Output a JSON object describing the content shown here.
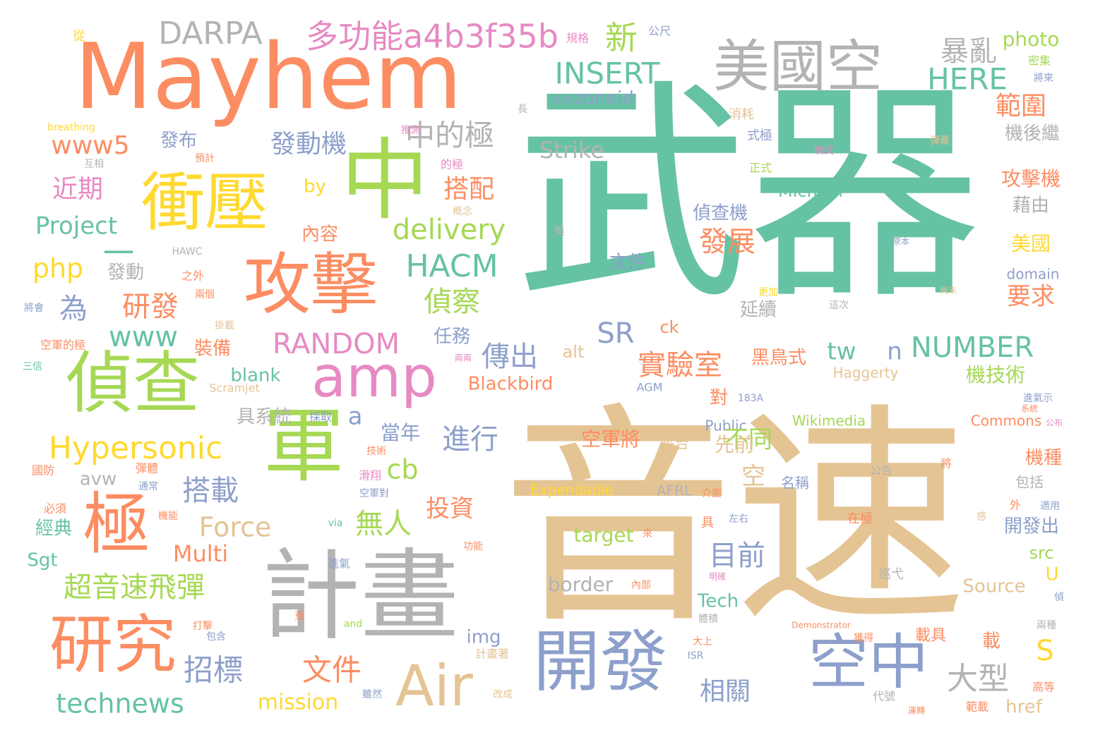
{
  "palette": {
    "teal": "#66c2a5",
    "orange": "#fc8d62",
    "blue": "#8da0cb",
    "pink": "#e78ac3",
    "green": "#a6d854",
    "yellow": "#ffd92f",
    "tan": "#e5c494",
    "gray": "#b3b3b3"
  },
  "words": [
    {
      "text": "武器",
      "color": "teal"
    },
    {
      "text": "音速",
      "color": "tan"
    },
    {
      "text": "Mayhem",
      "color": "orange"
    },
    {
      "text": "計畫",
      "color": "gray"
    },
    {
      "text": "美國空",
      "color": "gray"
    },
    {
      "text": "中",
      "color": "green"
    },
    {
      "text": "衝壓",
      "color": "yellow"
    },
    {
      "text": "偵查",
      "color": "green"
    },
    {
      "text": "攻擊",
      "color": "orange"
    },
    {
      "text": "軍",
      "color": "green"
    },
    {
      "text": "開發",
      "color": "blue"
    },
    {
      "text": "研究",
      "color": "orange"
    },
    {
      "text": "空中",
      "color": "blue"
    },
    {
      "text": "Air",
      "color": "tan"
    },
    {
      "text": "amp",
      "color": "pink"
    },
    {
      "text": "極",
      "color": "orange"
    },
    {
      "text": "多功能a4b3f35b",
      "color": "pink"
    },
    {
      "text": "DARPA",
      "color": "gray"
    },
    {
      "text": "新",
      "color": "green"
    },
    {
      "text": "暴亂",
      "color": "gray"
    },
    {
      "text": "photo",
      "color": "green"
    },
    {
      "text": "INSERT",
      "color": "teal"
    },
    {
      "text": "HERE",
      "color": "teal"
    },
    {
      "text": "zoneid",
      "color": "blue"
    },
    {
      "text": "範圍",
      "color": "orange"
    },
    {
      "text": "中的極",
      "color": "gray"
    },
    {
      "text": "發動機",
      "color": "blue"
    },
    {
      "text": "發布",
      "color": "blue"
    },
    {
      "text": "www5",
      "color": "orange"
    },
    {
      "text": "Strike",
      "color": "gray"
    },
    {
      "text": "機後繼",
      "color": "gray"
    },
    {
      "text": "近期",
      "color": "pink"
    },
    {
      "text": "搭配",
      "color": "orange"
    },
    {
      "text": "攻擊機",
      "color": "orange"
    },
    {
      "text": "by",
      "color": "yellow"
    },
    {
      "text": "Michael",
      "color": "teal"
    },
    {
      "text": "Project",
      "color": "teal"
    },
    {
      "text": "delivery",
      "color": "green"
    },
    {
      "text": "偵查機",
      "color": "blue"
    },
    {
      "text": "藉由",
      "color": "gray"
    },
    {
      "text": "一",
      "color": "teal"
    },
    {
      "text": "內容",
      "color": "orange"
    },
    {
      "text": "發展",
      "color": "orange"
    },
    {
      "text": "美國",
      "color": "yellow"
    },
    {
      "text": "php",
      "color": "yellow"
    },
    {
      "text": "HACM",
      "color": "teal"
    },
    {
      "text": "文件",
      "color": "blue"
    },
    {
      "text": "domain",
      "color": "blue"
    },
    {
      "text": "發動",
      "color": "gray"
    },
    {
      "text": "為",
      "color": "blue"
    },
    {
      "text": "研發",
      "color": "orange"
    },
    {
      "text": "偵察",
      "color": "green"
    },
    {
      "text": "要求",
      "color": "orange"
    },
    {
      "text": "www",
      "color": "teal"
    },
    {
      "text": "SR",
      "color": "blue"
    },
    {
      "text": "延續",
      "color": "gray"
    },
    {
      "text": "ck",
      "color": "orange"
    },
    {
      "text": "RANDOM",
      "color": "pink"
    },
    {
      "text": "任務",
      "color": "blue"
    },
    {
      "text": "tw",
      "color": "teal"
    },
    {
      "text": "n",
      "color": "blue"
    },
    {
      "text": "NUMBER",
      "color": "teal"
    },
    {
      "text": "裝備",
      "color": "orange"
    },
    {
      "text": "傳出",
      "color": "blue"
    },
    {
      "text": "實驗室",
      "color": "orange"
    },
    {
      "text": "黑鳥式",
      "color": "orange"
    },
    {
      "text": "alt",
      "color": "tan"
    },
    {
      "text": "機技術",
      "color": "green"
    },
    {
      "text": "blank",
      "color": "teal"
    },
    {
      "text": "Blackbird",
      "color": "orange"
    },
    {
      "text": "Haggerty",
      "color": "tan"
    },
    {
      "text": "具系統",
      "color": "gray"
    },
    {
      "text": "a",
      "color": "blue"
    },
    {
      "text": "當年",
      "color": "blue"
    },
    {
      "text": "對",
      "color": "orange"
    },
    {
      "text": "Wikimedia",
      "color": "green"
    },
    {
      "text": "Commons",
      "color": "orange"
    },
    {
      "text": "Hypersonic",
      "color": "yellow"
    },
    {
      "text": "進行",
      "color": "blue"
    },
    {
      "text": "空軍將",
      "color": "orange"
    },
    {
      "text": "Public",
      "color": "blue"
    },
    {
      "text": "不同",
      "color": "green"
    },
    {
      "text": "S",
      "color": "yellow"
    },
    {
      "text": "cb",
      "color": "green"
    },
    {
      "text": "平台",
      "color": "tan"
    },
    {
      "text": "先前",
      "color": "tan"
    },
    {
      "text": "機種",
      "color": "orange"
    },
    {
      "text": "avw",
      "color": "gray"
    },
    {
      "text": "搭載",
      "color": "blue"
    },
    {
      "text": "空",
      "color": "tan"
    },
    {
      "text": "名稱",
      "color": "blue"
    },
    {
      "text": "包括",
      "color": "gray"
    },
    {
      "text": "Expendable",
      "color": "yellow"
    },
    {
      "text": "AFRL",
      "color": "gray"
    },
    {
      "text": "投資",
      "color": "orange"
    },
    {
      "text": "無人",
      "color": "green"
    },
    {
      "text": "Force",
      "color": "tan"
    },
    {
      "text": "開發出",
      "color": "blue"
    },
    {
      "text": "經典",
      "color": "teal"
    },
    {
      "text": "target",
      "color": "green"
    },
    {
      "text": "Multi",
      "color": "orange"
    },
    {
      "text": "目前",
      "color": "blue"
    },
    {
      "text": "src",
      "color": "green"
    },
    {
      "text": "Sgt",
      "color": "teal"
    },
    {
      "text": "超音速飛彈",
      "color": "green"
    },
    {
      "text": "border",
      "color": "gray"
    },
    {
      "text": "Source",
      "color": "tan"
    },
    {
      "text": "Tech",
      "color": "teal"
    },
    {
      "text": "img",
      "color": "blue"
    },
    {
      "text": "相關",
      "color": "blue"
    },
    {
      "text": "大型",
      "color": "gray"
    },
    {
      "text": "招標",
      "color": "blue"
    },
    {
      "text": "文件",
      "color": "orange"
    },
    {
      "text": "載具",
      "color": "orange"
    },
    {
      "text": "載",
      "color": "orange"
    },
    {
      "text": "technews",
      "color": "teal"
    },
    {
      "text": "mission",
      "color": "yellow"
    },
    {
      "text": "href",
      "color": "tan"
    },
    {
      "text": "從",
      "color": "yellow"
    },
    {
      "text": "規格",
      "color": "pink"
    },
    {
      "text": "公尺",
      "color": "blue"
    },
    {
      "text": "密集",
      "color": "green"
    },
    {
      "text": "將來",
      "color": "blue"
    },
    {
      "text": "長",
      "color": "gray"
    },
    {
      "text": "即將",
      "color": "blue"
    },
    {
      "text": "消耗",
      "color": "tan"
    },
    {
      "text": "breathing",
      "color": "yellow"
    },
    {
      "text": "推測",
      "color": "pink"
    },
    {
      "text": "式極",
      "color": "blue"
    },
    {
      "text": "彈藥",
      "color": "tan"
    },
    {
      "text": "模式",
      "color": "pink"
    },
    {
      "text": "預計",
      "color": "orange"
    },
    {
      "text": "互相",
      "color": "gray"
    },
    {
      "text": "的極",
      "color": "pink"
    },
    {
      "text": "正式",
      "color": "green"
    },
    {
      "text": "概念",
      "color": "tan"
    },
    {
      "text": "美",
      "color": "gray"
    },
    {
      "text": "HAWC",
      "color": "gray"
    },
    {
      "text": "原本",
      "color": "blue"
    },
    {
      "text": "之外",
      "color": "orange"
    },
    {
      "text": "兩個",
      "color": "orange"
    },
    {
      "text": "更加",
      "color": "yellow"
    },
    {
      "text": "尚未",
      "color": "tan"
    },
    {
      "text": "將會",
      "color": "blue"
    },
    {
      "text": "這次",
      "color": "gray"
    },
    {
      "text": "掛載",
      "color": "tan"
    },
    {
      "text": "空軍的極",
      "color": "orange"
    },
    {
      "text": "兩兩",
      "color": "pink"
    },
    {
      "text": "三信",
      "color": "teal"
    },
    {
      "text": "Scramjet",
      "color": "tan"
    },
    {
      "text": "AGM",
      "color": "blue"
    },
    {
      "text": "183A",
      "color": "blue"
    },
    {
      "text": "進氣示",
      "color": "blue"
    },
    {
      "text": "系統",
      "color": "orange"
    },
    {
      "text": "採取",
      "color": "blue"
    },
    {
      "text": "技術",
      "color": "orange"
    },
    {
      "text": "公布",
      "color": "pink"
    },
    {
      "text": "彈體",
      "color": "orange"
    },
    {
      "text": "滑翔",
      "color": "pink"
    },
    {
      "text": "將",
      "color": "orange"
    },
    {
      "text": "國防",
      "color": "orange"
    },
    {
      "text": "通常",
      "color": "blue"
    },
    {
      "text": "空軍對",
      "color": "blue"
    },
    {
      "text": "公告",
      "color": "gray"
    },
    {
      "text": "必須",
      "color": "orange"
    },
    {
      "text": "介面",
      "color": "orange"
    },
    {
      "text": "外",
      "color": "orange"
    },
    {
      "text": "適用",
      "color": "blue"
    },
    {
      "text": "機能",
      "color": "orange"
    },
    {
      "text": "via",
      "color": "teal"
    },
    {
      "text": "具",
      "color": "orange"
    },
    {
      "text": "左右",
      "color": "blue"
    },
    {
      "text": "在極",
      "color": "orange"
    },
    {
      "text": "感",
      "color": "tan"
    },
    {
      "text": "功能",
      "color": "orange"
    },
    {
      "text": "來",
      "color": "orange"
    },
    {
      "text": "巡弋",
      "color": "gray"
    },
    {
      "text": "U",
      "color": "yellow"
    },
    {
      "text": "進氣",
      "color": "blue"
    },
    {
      "text": "內部",
      "color": "orange"
    },
    {
      "text": "明確",
      "color": "pink"
    },
    {
      "text": "偵",
      "color": "blue"
    },
    {
      "text": "蒐",
      "color": "orange"
    },
    {
      "text": "體積",
      "color": "gray"
    },
    {
      "text": "打擊",
      "color": "orange"
    },
    {
      "text": "and",
      "color": "green"
    },
    {
      "text": "Demonstrator",
      "color": "orange"
    },
    {
      "text": "兩種",
      "color": "gray"
    },
    {
      "text": "包含",
      "color": "blue"
    },
    {
      "text": "大上",
      "color": "orange"
    },
    {
      "text": "ISR",
      "color": "blue"
    },
    {
      "text": "獲得",
      "color": "orange"
    },
    {
      "text": "計畫著",
      "color": "tan"
    },
    {
      "text": "雖然",
      "color": "blue"
    },
    {
      "text": "改成",
      "color": "tan"
    },
    {
      "text": "代號",
      "color": "gray"
    },
    {
      "text": "運轉",
      "color": "orange"
    },
    {
      "text": "範載",
      "color": "orange"
    },
    {
      "text": "高等",
      "color": "orange"
    }
  ]
}
